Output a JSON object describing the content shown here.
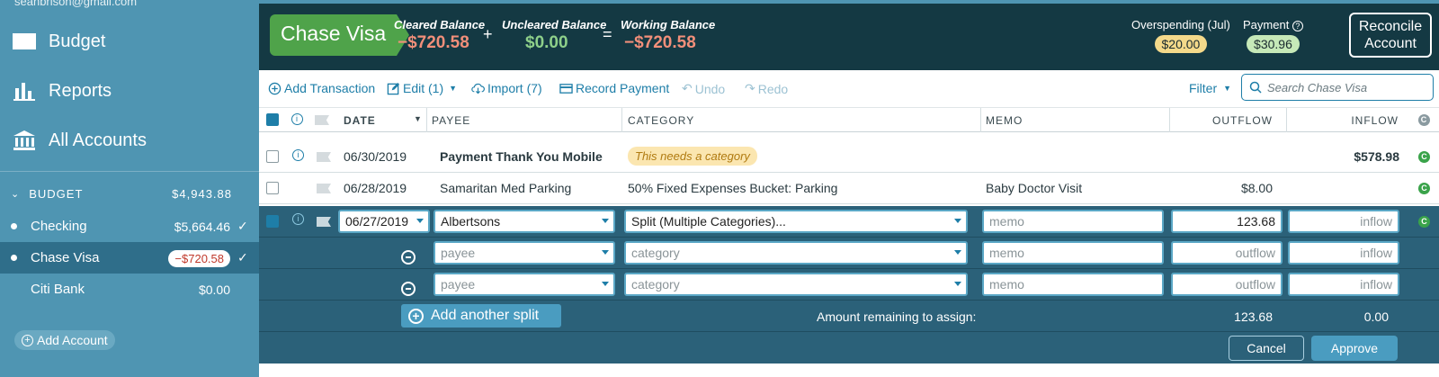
{
  "sidebar": {
    "email": "seanbrison@gmail.com",
    "nav": [
      {
        "label": "Budget",
        "icon": "envelope-icon"
      },
      {
        "label": "Reports",
        "icon": "bar-chart-icon"
      },
      {
        "label": "All Accounts",
        "icon": "bank-icon"
      }
    ],
    "budget_header": {
      "label": "BUDGET",
      "total": "$4,943.88"
    },
    "accounts": [
      {
        "name": "Checking",
        "balance": "$5,664.46",
        "check": "✓"
      },
      {
        "name": "Chase Visa",
        "balance": "−$720.58",
        "check": "✓"
      },
      {
        "name": "Citi Bank",
        "balance": "$0.00",
        "check": ""
      }
    ],
    "add_account": "Add Account"
  },
  "header": {
    "account_name": "Chase Visa",
    "cleared": {
      "label": "Cleared Balance",
      "value": "−$720.58"
    },
    "plus": "+",
    "uncleared": {
      "label": "Uncleared Balance",
      "value": "$0.00"
    },
    "equals": "=",
    "working": {
      "label": "Working Balance",
      "value": "−$720.58"
    },
    "overspending": {
      "label": "Overspending (Jul)",
      "value": "$20.00"
    },
    "payment": {
      "label": "Payment",
      "value": "$30.96"
    },
    "reconcile": {
      "line1": "Reconcile",
      "line2": "Account"
    },
    "colors": {
      "green": "#4fa34a",
      "negative": "#f28f7a",
      "positive": "#8ed08a"
    }
  },
  "toolbar": {
    "add_transaction": "Add Transaction",
    "edit": "Edit (1)",
    "import": "Import (7)",
    "record_payment": "Record Payment",
    "undo": "Undo",
    "redo": "Redo",
    "filter": "Filter",
    "search_placeholder": "Search Chase Visa"
  },
  "columns": {
    "date": "DATE",
    "payee": "PAYEE",
    "category": "CATEGORY",
    "memo": "MEMO",
    "outflow": "OUTFLOW",
    "inflow": "INFLOW"
  },
  "rows": [
    {
      "date": "06/30/2019",
      "payee": "Payment Thank You Mobile",
      "category": "This needs a category",
      "memo": "",
      "outflow": "",
      "inflow": "$578.98"
    },
    {
      "date": "06/28/2019",
      "payee": "Samaritan Med Parking",
      "category": "50% Fixed Expenses Bucket: Parking",
      "memo": "Baby Doctor Visit",
      "outflow": "$8.00",
      "inflow": ""
    }
  ],
  "edit": {
    "date": "06/27/2019",
    "payee": "Albertsons",
    "category": "Split (Multiple Categories)...",
    "memo_placeholder": "memo",
    "outflow": "123.68",
    "inflow_placeholder": "inflow",
    "splits": [
      {
        "payee_placeholder": "payee",
        "category_placeholder": "category",
        "memo_placeholder": "memo",
        "outflow_placeholder": "outflow",
        "inflow_placeholder": "inflow"
      },
      {
        "payee_placeholder": "payee",
        "category_placeholder": "category",
        "memo_placeholder": "memo",
        "outflow_placeholder": "outflow",
        "inflow_placeholder": "inflow"
      }
    ],
    "add_split": "Add another split",
    "remaining_label": "Amount remaining to assign:",
    "remaining_outflow": "123.68",
    "remaining_inflow": "0.00",
    "cancel": "Cancel",
    "approve": "Approve"
  },
  "cleared_marker": "C"
}
